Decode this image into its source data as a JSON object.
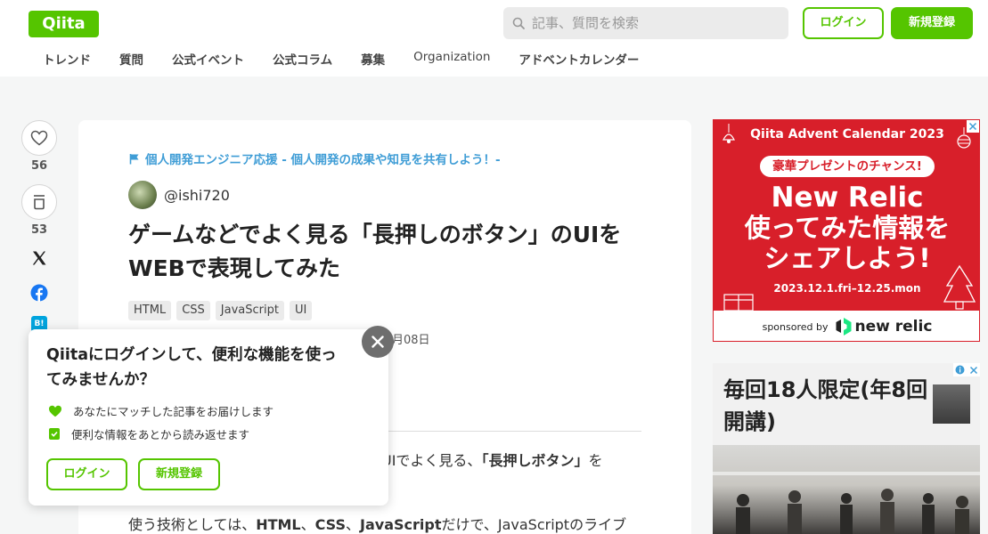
{
  "header": {
    "logo": "Qiita",
    "search_placeholder": "記事、質問を検索",
    "login_label": "ログイン",
    "signup_label": "新規登録",
    "nav": [
      "トレンド",
      "質問",
      "公式イベント",
      "公式コラム",
      "募集",
      "Organization",
      "アドベントカレンダー"
    ]
  },
  "rail": {
    "likes": "56",
    "stocks": "53",
    "hatena": "B!",
    "more": "•••"
  },
  "article": {
    "event": "個人開発エンジニア応援 - 個人開発の成果や知見を共有しよう！-",
    "author": "@ishi720",
    "title": "ゲームなどでよく見る「長押しのボタン」のUIをWEBで表現してみた",
    "tags": [
      "HTML",
      "CSS",
      "JavaScript",
      "UI"
    ],
    "date_fragment": "月08日",
    "body1_pre": "UIでよく見る、",
    "body1_bold": "「長押しボタン」",
    "body1_post": "を",
    "body2_pre": "使う技術としては、",
    "body2_b1": "HTML",
    "body2_sep1": "、",
    "body2_b2": "CSS",
    "body2_sep2": "、",
    "body2_b3": "JavaScript",
    "body2_post": "だけで、JavaScriptのライブ"
  },
  "popup": {
    "title": "Qiitaにログインして、便利な機能を使ってみませんか？",
    "item1": "あなたにマッチした記事をお届けします",
    "item2": "便利な情報をあとから読み返せます",
    "login_label": "ログイン",
    "signup_label": "新規登録"
  },
  "ad1": {
    "heading": "Qiita Advent Calendar 2023",
    "pill": "豪華プレゼントのチャンス!",
    "big_line1": "New Relic",
    "big_line2": "使ってみた情報を",
    "big_line3": "シェアしよう!",
    "date": "2023.12.1.fri–12.25.mon",
    "sponsored": "sponsored by",
    "brand": "new relic"
  },
  "ad2": {
    "text": "毎回18人限定(年8回開講)"
  },
  "colors": {
    "brand_green": "#55c500",
    "link_blue": "#3f9dd6",
    "ad_red": "#d81f2a"
  }
}
